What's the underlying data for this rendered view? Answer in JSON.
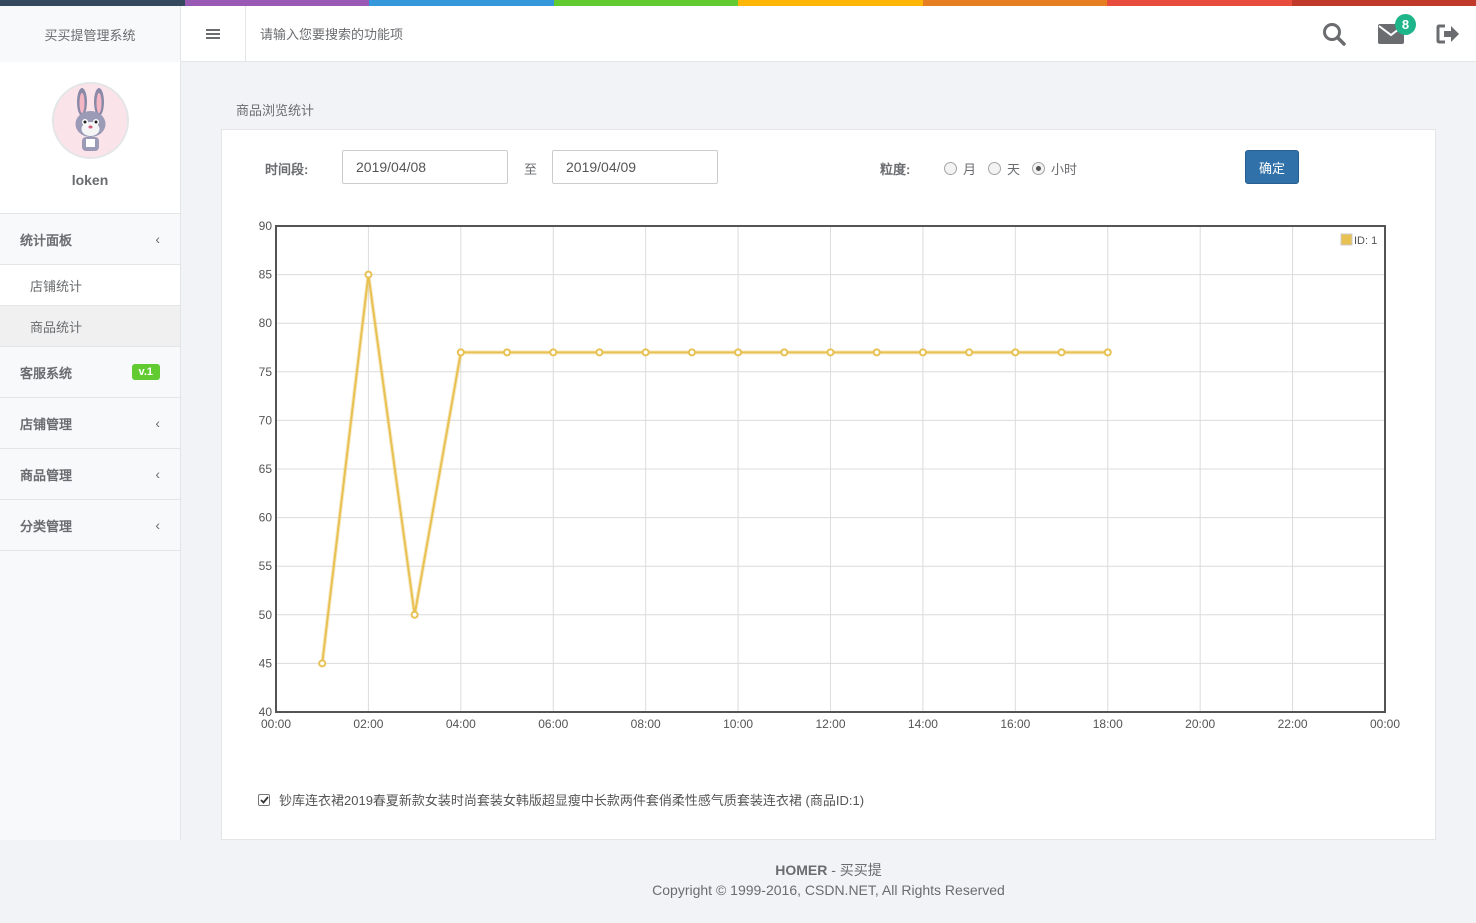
{
  "header": {
    "app_title": "买买提管理系统",
    "search_placeholder": "请输入您要搜索的功能项",
    "mail_count": "8",
    "color_line": [
      "#34495e",
      "#9b59b6",
      "#3498db",
      "#62cb31",
      "#ffb606",
      "#e67e22",
      "#e74c3c",
      "#c0392b"
    ]
  },
  "sidebar": {
    "username": "loken",
    "menu": [
      {
        "label": "统计面板",
        "icon": "chevron-left-icon"
      },
      {
        "label": "店铺统计"
      },
      {
        "label": "商品统计"
      },
      {
        "label": "客服系统",
        "badge": "v.1"
      },
      {
        "label": "店铺管理",
        "icon": "chevron-left-icon"
      },
      {
        "label": "商品管理",
        "icon": "chevron-left-icon"
      },
      {
        "label": "分类管理",
        "icon": "chevron-left-icon"
      }
    ]
  },
  "main": {
    "page_title": "商品浏览统计",
    "filter": {
      "period_label": "时间段:",
      "start_date": "2019/04/08",
      "separator": "至",
      "end_date": "2019/04/09",
      "granularity_label": "粒度:",
      "options": [
        "月",
        "天",
        "小时"
      ],
      "selected": "小时",
      "confirm_label": "确定"
    },
    "product_checkbox": {
      "checked": true,
      "label": "钞库连衣裙2019春夏新款女装时尚套装女韩版超显瘦中长款两件套俏柔性感气质套装连衣裙 (商品ID:1)"
    }
  },
  "chart_data": {
    "type": "line",
    "x_labels": [
      "00:00",
      "02:00",
      "04:00",
      "06:00",
      "08:00",
      "10:00",
      "12:00",
      "14:00",
      "16:00",
      "18:00",
      "20:00",
      "22:00",
      "00:00"
    ],
    "y_ticks": [
      40,
      45,
      50,
      55,
      60,
      65,
      70,
      75,
      80,
      85,
      90
    ],
    "ylim": [
      40,
      90
    ],
    "x_range_hours": [
      0,
      24
    ],
    "grid": true,
    "legend_position": "top-right",
    "series": [
      {
        "name": "ID: 1",
        "color": "#e8c153",
        "x": [
          "01:00",
          "02:00",
          "03:00",
          "04:00",
          "05:00",
          "06:00",
          "07:00",
          "08:00",
          "09:00",
          "10:00",
          "11:00",
          "12:00",
          "13:00",
          "14:00",
          "15:00",
          "16:00",
          "17:00",
          "18:00"
        ],
        "values": [
          45,
          85,
          50,
          77,
          77,
          77,
          77,
          77,
          77,
          77,
          77,
          77,
          77,
          77,
          77,
          77,
          77,
          77
        ]
      }
    ]
  },
  "footer": {
    "brand": "HOMER",
    "brand_suffix": " - 买买提",
    "copyright": "Copyright © 1999-2016, CSDN.NET, All Rights Reserved"
  }
}
